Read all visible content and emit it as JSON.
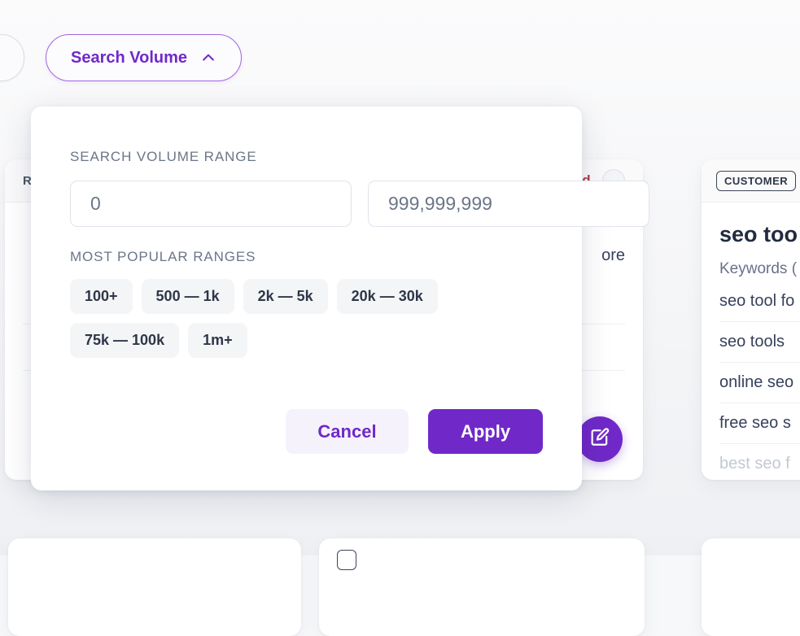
{
  "background": {
    "filter_pills": [
      {
        "label": "",
        "icon": "",
        "state": "clipped"
      },
      {
        "label": "Search Volume",
        "icon": "chevron-up-icon",
        "state": "active"
      }
    ],
    "middle_card": {
      "header_left": "RKD",
      "header_right": "rd",
      "header_circle_icon": "circle-toggle-icon",
      "body_text": "ore"
    },
    "right_card": {
      "badge": "CUSTOMER",
      "title": "seo too",
      "subtitle": "Keywords (",
      "keywords": [
        "seo tool fo",
        "seo tools",
        "online seo",
        "free seo s",
        "best seo f"
      ]
    },
    "fab": {
      "icon": "edit-compose-icon",
      "color": "#7029c8"
    }
  },
  "modal": {
    "section_label": "SEARCH VOLUME RANGE",
    "min_input": {
      "value": "",
      "placeholder": "0"
    },
    "max_input": {
      "value": "",
      "placeholder": "999,999,999"
    },
    "ranges_label": "MOST POPULAR RANGES",
    "range_chips": [
      "100+",
      "500 — 1k",
      "2k — 5k",
      "20k — 30k",
      "75k — 100k",
      "1m+"
    ],
    "cancel_label": "Cancel",
    "apply_label": "Apply"
  },
  "colors": {
    "accent_purple": "#7029c8",
    "accent_purple_light": "#f6f2fb",
    "text_muted": "#6b7689",
    "text_dark": "#2e3648",
    "border": "#dfe3ea",
    "chip_bg": "#f4f5f7",
    "red_label": "#b53a4b"
  }
}
